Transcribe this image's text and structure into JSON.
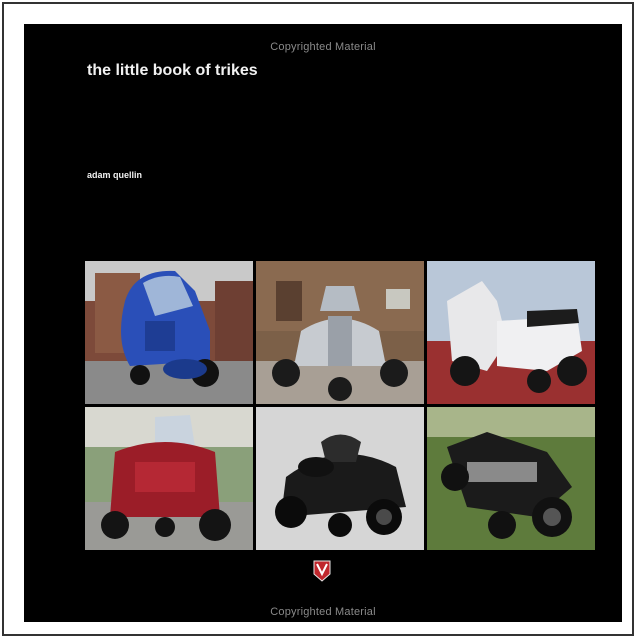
{
  "watermark_top": "Copyrighted Material",
  "watermark_bottom": "Copyrighted Material",
  "title": "the little book of trikes",
  "author": "adam quellin",
  "photos": [
    {
      "subject": "blue enclosed trike"
    },
    {
      "subject": "silver three-wheel roadster"
    },
    {
      "subject": "white scooter trike"
    },
    {
      "subject": "red touring trike"
    },
    {
      "subject": "black three-wheel roadster"
    },
    {
      "subject": "black chopper trike"
    }
  ],
  "colors": {
    "cover": "#000000",
    "title_text": "#f2f2f2",
    "watermark": "#8a8a8a",
    "logo_red": "#c0272d"
  }
}
